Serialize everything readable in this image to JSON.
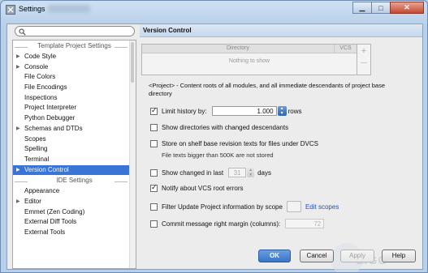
{
  "window": {
    "title": "Settings"
  },
  "search": {
    "value": ""
  },
  "tree": {
    "project_group": "Template Project Settings",
    "project_items": [
      {
        "label": "Code Style",
        "arrow": true
      },
      {
        "label": "Console",
        "arrow": true
      },
      {
        "label": "File Colors",
        "arrow": false
      },
      {
        "label": "File Encodings",
        "arrow": false
      },
      {
        "label": "Inspections",
        "arrow": false
      },
      {
        "label": "Project Interpreter",
        "arrow": false
      },
      {
        "label": "Python Debugger",
        "arrow": false
      },
      {
        "label": "Schemas and DTDs",
        "arrow": true
      },
      {
        "label": "Scopes",
        "arrow": false
      },
      {
        "label": "Spelling",
        "arrow": false
      },
      {
        "label": "Terminal",
        "arrow": false
      },
      {
        "label": "Version Control",
        "arrow": true,
        "selected": true
      }
    ],
    "ide_group": "IDE Settings",
    "ide_items": [
      {
        "label": "Appearance",
        "arrow": false
      },
      {
        "label": "Editor",
        "arrow": true
      },
      {
        "label": "Emmet (Zen Coding)",
        "arrow": false
      },
      {
        "label": "External Diff Tools",
        "arrow": false
      },
      {
        "label": "External Tools",
        "arrow": false
      }
    ]
  },
  "panel": {
    "title": "Version Control",
    "table": {
      "col_directory": "Directory",
      "col_vcs": "VCS",
      "empty_text": "Nothing to show"
    },
    "description": "<Project> - Content roots of all modules, and all immediate descendants of project base directory",
    "options": {
      "limit_history": {
        "label": "Limit history by:",
        "checked": true,
        "value": "1.000",
        "unit": "rows"
      },
      "show_dirs": {
        "label": "Show directories with changed descendants",
        "checked": false
      },
      "store_shelf": {
        "label": "Store on shelf base revision texts for files under DVCS",
        "checked": false,
        "hint": "File texts bigger than 500K are not stored"
      },
      "show_changed": {
        "label": "Show changed in last",
        "checked": false,
        "value": "31",
        "unit": "days"
      },
      "notify_vcs": {
        "label": "Notify about VCS root errors",
        "checked": true
      },
      "filter_update": {
        "label": "Filter Update Project information by scope",
        "checked": false,
        "link": "Edit scopes"
      },
      "commit_margin": {
        "label": "Commit message right margin (columns):",
        "checked": false,
        "value": "72"
      }
    }
  },
  "buttons": {
    "ok": "OK",
    "cancel": "Cancel",
    "apply": "Apply",
    "help": "Help"
  },
  "watermark": "ZIGG",
  "colors": {
    "selection": "#3875d7",
    "primary_button": "#3873c6",
    "link": "#2250b8"
  }
}
